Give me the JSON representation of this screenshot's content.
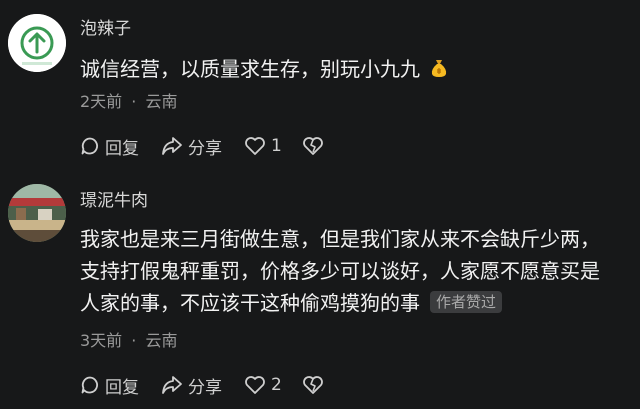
{
  "comments": [
    {
      "username": "泡辣子",
      "text": [
        "诚信经营，以质量求生存，别玩小九九"
      ],
      "time": "2天前",
      "location": "云南",
      "reply_label": "回复",
      "share_label": "分享",
      "like_count": "1",
      "avatar_icon": "up-arrow-icon",
      "emoji_icon": "money-bag-icon"
    },
    {
      "username": "璟泥牛肉",
      "text": [
        "我家也是来三月街做生意，但是我们家从来不会缺斤少两，",
        "支持打假鬼秤重罚，价格多少可以谈好，人家愿不愿意买是",
        "人家的事，不应该干这种偷鸡摸狗的事"
      ],
      "badge": "作者赞过",
      "time": "3天前",
      "location": "云南",
      "reply_label": "回复",
      "share_label": "分享",
      "like_count": "2",
      "avatar_icon": "market-photo"
    }
  ],
  "meta_separator": "·",
  "colors": {
    "background": "#171819",
    "primary_text": "#f2f2f2",
    "secondary_text": "#9a9a9a",
    "avatar_green": "#3a9a54",
    "badge_bg": "#3b3c3e"
  }
}
